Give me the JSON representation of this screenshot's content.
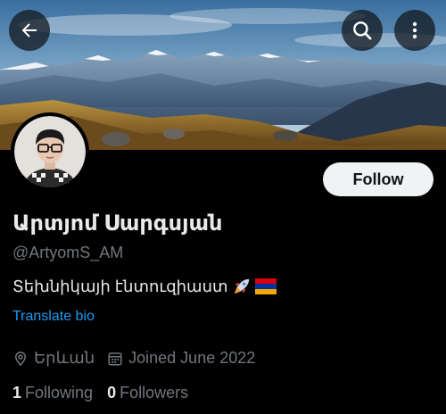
{
  "profile": {
    "display_name": "Արտյոմ Սարգսյան",
    "handle": "@ArtyomS_AM",
    "bio_text": "Տեխնիկայի էնտուզիաստ",
    "bio_emojis": [
      "rocket",
      "armenia-flag"
    ],
    "translate_label": "Translate bio",
    "location": "Երևան",
    "joined": "Joined June 2022",
    "following_count": "1",
    "following_label": "Following",
    "followers_count": "0",
    "followers_label": "Followers"
  },
  "actions": {
    "follow_label": "Follow"
  },
  "icons": {
    "back": "arrow-left-icon",
    "search": "search-icon",
    "more": "more-vertical-icon",
    "location": "location-pin-icon",
    "calendar": "calendar-icon"
  },
  "colors": {
    "background": "#000000",
    "text_primary": "#e7e9ea",
    "text_secondary": "#71767b",
    "link": "#1d9bf0",
    "button_bg": "#eff3f4"
  }
}
